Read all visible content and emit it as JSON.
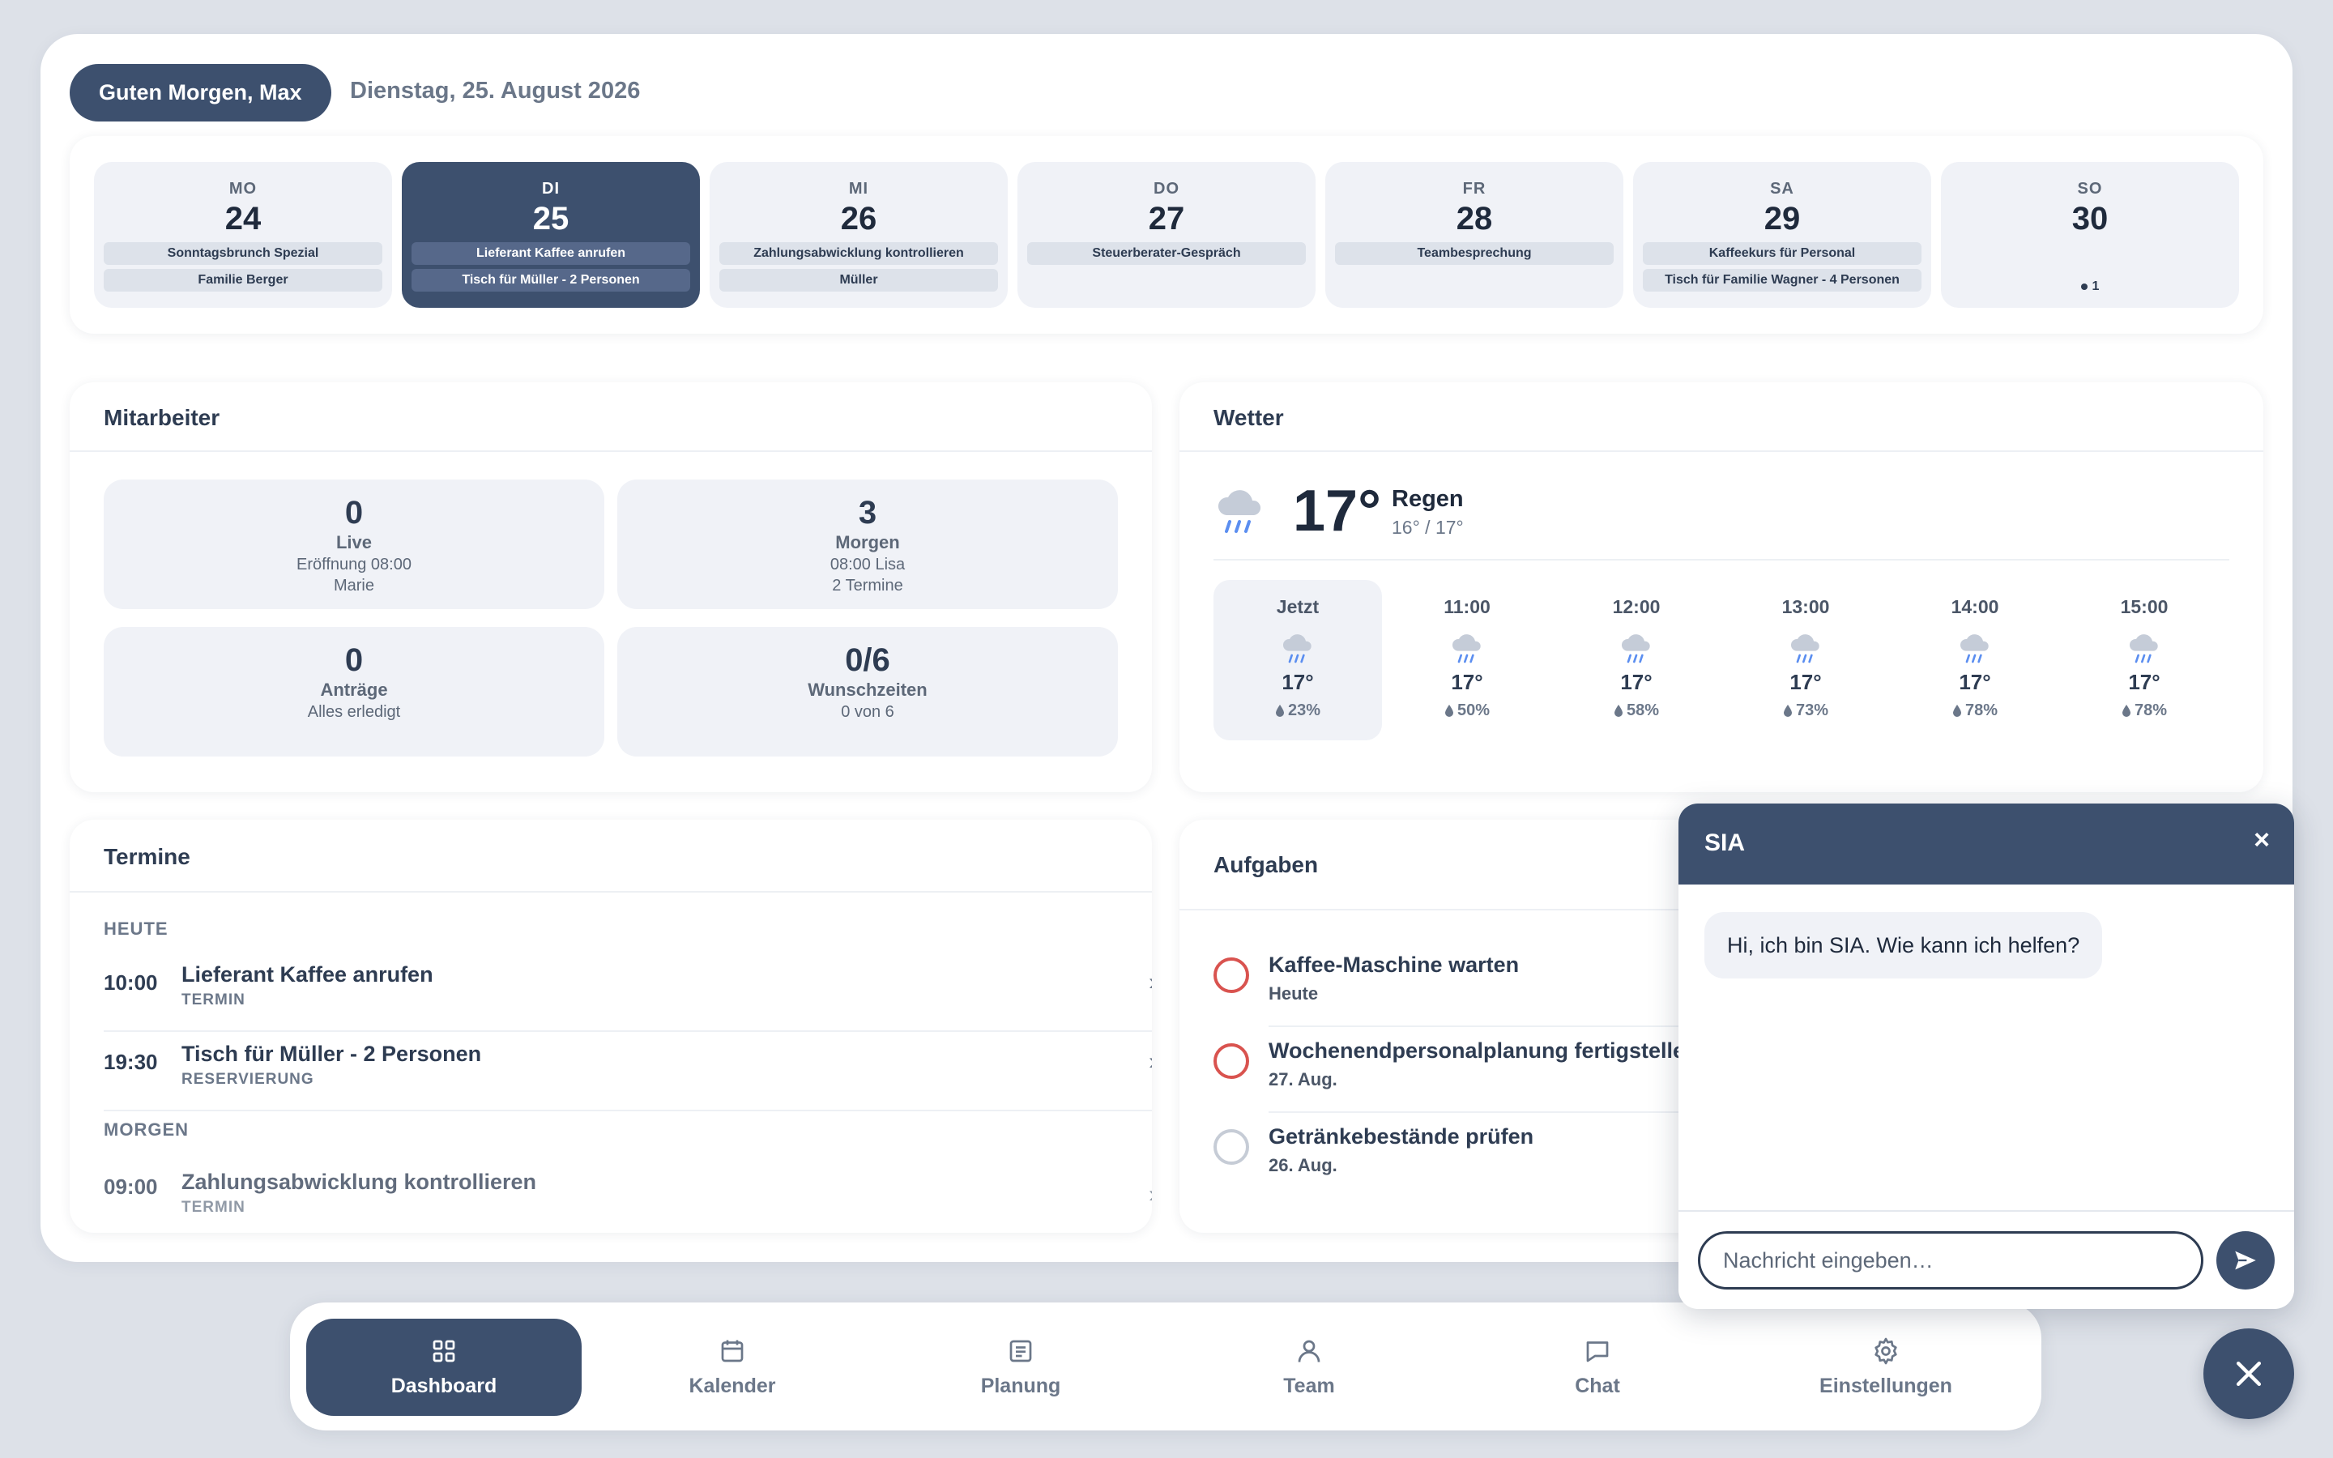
{
  "header": {
    "greeting": "Guten Morgen, Max",
    "date": "Dienstag, 25. August 2026"
  },
  "week": [
    {
      "dn": "MO",
      "dd": "24",
      "events": [
        "Sonntagsbrunch Spezial",
        "Familie Berger"
      ]
    },
    {
      "dn": "DI",
      "dd": "25",
      "events": [
        "Lieferant Kaffee anrufen",
        "Tisch für Müller - 2 Personen"
      ],
      "active": true
    },
    {
      "dn": "MI",
      "dd": "26",
      "events": [
        "Zahlungsabwicklung kontrollieren",
        "Müller"
      ]
    },
    {
      "dn": "DO",
      "dd": "27",
      "events": [
        "Steuerberater-Gespräch"
      ]
    },
    {
      "dn": "FR",
      "dd": "28",
      "events": [
        "Teambesprechung"
      ]
    },
    {
      "dn": "SA",
      "dd": "29",
      "events": [
        "Kaffeekurs für Personal",
        "Tisch für Familie Wagner - 4 Personen"
      ]
    },
    {
      "dn": "SO",
      "dd": "30",
      "events": [],
      "more": "1"
    }
  ],
  "staff": {
    "title": "Mitarbeiter",
    "live": {
      "value": "0",
      "label": "Live",
      "sub1": "Eröffnung 08:00",
      "sub2": "Marie"
    },
    "tomorrow": {
      "value": "3",
      "label": "Morgen",
      "sub1": "08:00 Lisa",
      "sub2": "2 Termine"
    },
    "requests": {
      "value": "0",
      "label": "Anträge",
      "sub1": "Alles erledigt"
    },
    "wishes": {
      "value": "0/6",
      "label": "Wunschzeiten",
      "sub1": "0 von 6"
    }
  },
  "weather": {
    "title": "Wetter",
    "temp": "17°",
    "desc": "Regen",
    "range": "16° / 17°",
    "hours": [
      {
        "t": "Jetzt",
        "tp": "17°",
        "pr": "23%"
      },
      {
        "t": "11:00",
        "tp": "17°",
        "pr": "50%"
      },
      {
        "t": "12:00",
        "tp": "17°",
        "pr": "58%"
      },
      {
        "t": "13:00",
        "tp": "17°",
        "pr": "73%"
      },
      {
        "t": "14:00",
        "tp": "17°",
        "pr": "78%"
      },
      {
        "t": "15:00",
        "tp": "17°",
        "pr": "78%"
      }
    ]
  },
  "appointments": {
    "title": "Termine",
    "today_label": "HEUTE",
    "tomorrow_label": "MORGEN",
    "today": [
      {
        "time": "10:00",
        "title": "Lieferant Kaffee anrufen",
        "type": "TERMIN"
      },
      {
        "time": "19:30",
        "title": "Tisch für Müller - 2 Personen",
        "type": "RESERVIERUNG"
      }
    ],
    "tomorrow": [
      {
        "time": "09:00",
        "title": "Zahlungsabwicklung kontrollieren",
        "type": "TERMIN"
      }
    ]
  },
  "tasks": {
    "title": "Aufgaben",
    "items": [
      {
        "title": "Kaffee-Maschine warten",
        "due": "Heute",
        "urgent": true
      },
      {
        "title": "Wochenendpersonalplanung fertigstellen",
        "due": "27. Aug.",
        "urgent": true
      },
      {
        "title": "Getränkebestände prüfen",
        "due": "26. Aug.",
        "urgent": false
      }
    ]
  },
  "nav": [
    {
      "label": "Dashboard",
      "icon": "grid-icon",
      "active": true
    },
    {
      "label": "Kalender",
      "icon": "calendar-icon"
    },
    {
      "label": "Planung",
      "icon": "list-icon"
    },
    {
      "label": "Team",
      "icon": "person-icon"
    },
    {
      "label": "Chat",
      "icon": "chat-icon"
    },
    {
      "label": "Einstellungen",
      "icon": "gear-icon"
    }
  ],
  "chat": {
    "name": "SIA",
    "close": "×",
    "greeting": "Hi, ich bin SIA. Wie kann ich helfen?",
    "placeholder": "Nachricht eingeben…"
  },
  "colors": {
    "primary": "#3d506e",
    "urgent": "#d9534f",
    "rain": "#5b8ef0"
  }
}
